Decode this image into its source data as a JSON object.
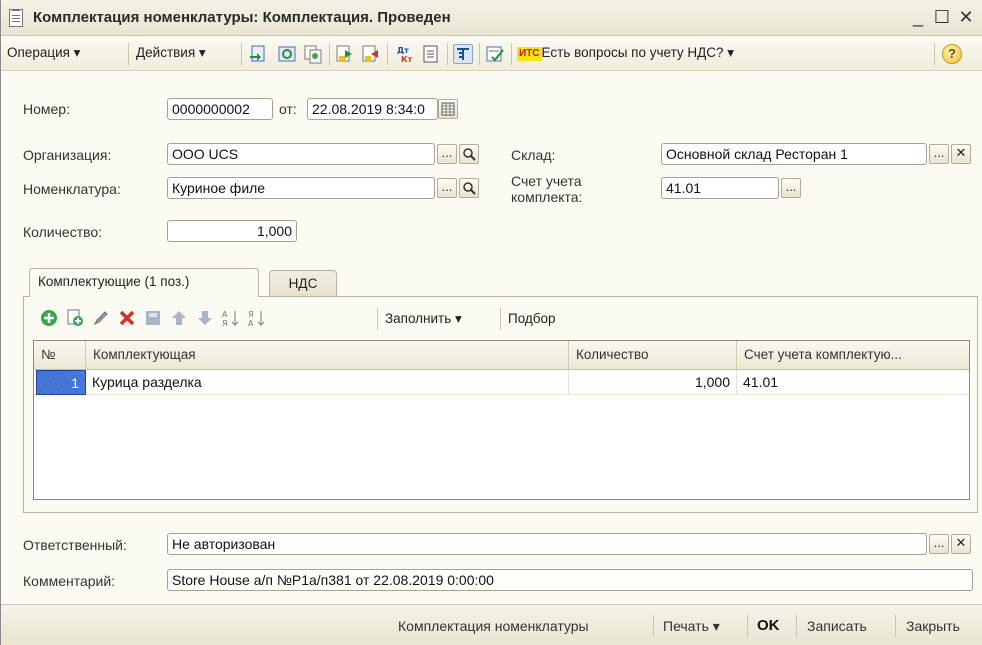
{
  "window": {
    "title": "Комплектация номенклатуры: Комплектация. Проведен",
    "minimize": "_",
    "maximize": "☐",
    "close": "✕"
  },
  "toolbar": {
    "operation": "Операция ▾",
    "actions": "Действия ▾",
    "its_badge": "ИТС",
    "vat_questions": "Есть вопросы по учету НДС? ▾",
    "help": "?"
  },
  "form": {
    "number_label": "Номер:",
    "number_value": "0000000002",
    "from_label": "от:",
    "date_value": "22.08.2019  8:34:0",
    "org_label": "Организация:",
    "org_value": "ООО UCS",
    "nomenclature_label": "Номенклатура:",
    "nomenclature_value": "Куриное филе",
    "quantity_label": "Количество:",
    "quantity_value": "1,000",
    "warehouse_label": "Склад:",
    "warehouse_value": "Основной склад Ресторан 1",
    "account_label_1": "Счет учета",
    "account_label_2": "комплекта:",
    "account_value": "41.01",
    "ellipsis": "...",
    "search_glyph": "Q",
    "clear_glyph": "✕"
  },
  "tabs": [
    {
      "label": "Комплектующие (1 поз.)"
    },
    {
      "label": "НДС"
    }
  ],
  "table_toolbar": {
    "fill": "Заполнить ▾",
    "pick": "Подбор"
  },
  "table": {
    "headers": [
      "№",
      "Комплектующая",
      "Количество",
      "Счет учета комплектую..."
    ],
    "rows": [
      {
        "num": "1",
        "item": "Курица разделка",
        "qty": "1,000",
        "account": "41.01"
      }
    ]
  },
  "footer_fields": {
    "responsible_label": "Ответственный:",
    "responsible_value": "Не авторизован",
    "comment_label": "Комментарий:",
    "comment_value": "Store House а/п №Р1а/п381 от 22.08.2019 0:00:00"
  },
  "bottom": {
    "doc_link": "Комплектация номенклатуры",
    "print": "Печать ▾",
    "ok": "OK",
    "save": "Записать",
    "close": "Закрыть"
  },
  "colors": {
    "window_bg": "#fbfaf3",
    "selection": "#2f62c7",
    "its_yellow": "#f5e316",
    "its_red": "#c8161e"
  }
}
